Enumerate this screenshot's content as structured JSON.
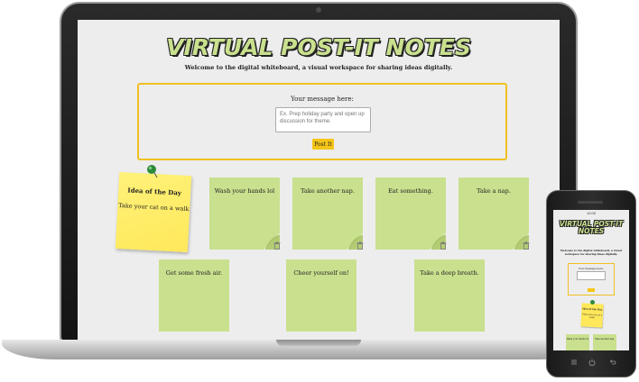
{
  "app": {
    "title": "VIRTUAL POST-IT NOTES",
    "subtitle": "Welcome to the digital whiteboard, a visual workspace for sharing ideas digitally."
  },
  "compose": {
    "label": "Your message here:",
    "placeholder": "Ex. Prep holiday party and open up discussion for theme.",
    "button_label": "Post It"
  },
  "idea_of_the_day": {
    "title": "Idea of the Day",
    "text": "Take your cat on a walk"
  },
  "notes": [
    {
      "text": "Wash your hands lol"
    },
    {
      "text": "Take another nap."
    },
    {
      "text": "Eat something."
    },
    {
      "text": "Take a nap."
    },
    {
      "text": "Get some fresh air."
    },
    {
      "text": "Cheer yourself on!"
    },
    {
      "text": "Take a deep breath."
    }
  ],
  "phone": {
    "status_time": "12:00",
    "title": "VIRTUAL POST-IT NOTES",
    "subtitle": "Welcome to the digital whiteboard, a visual workspace for sharing ideas digitally.",
    "compose_label": "Your message here:",
    "idea_title": "Idea of the Day",
    "idea_text": "Take your cat on a walk",
    "notes": [
      {
        "text": "Wash your hands lol"
      },
      {
        "text": "Take another nap."
      }
    ]
  },
  "icons": {
    "pushpin": "pushpin-icon",
    "trash": "trash-icon",
    "page_curl": "page-curl-icon"
  },
  "colors": {
    "note_green": "#c9e08e",
    "idea_yellow": "#ffe85a",
    "accent_yellow": "#f5c518",
    "compose_border": "#f0c020",
    "background": "#ededed"
  }
}
